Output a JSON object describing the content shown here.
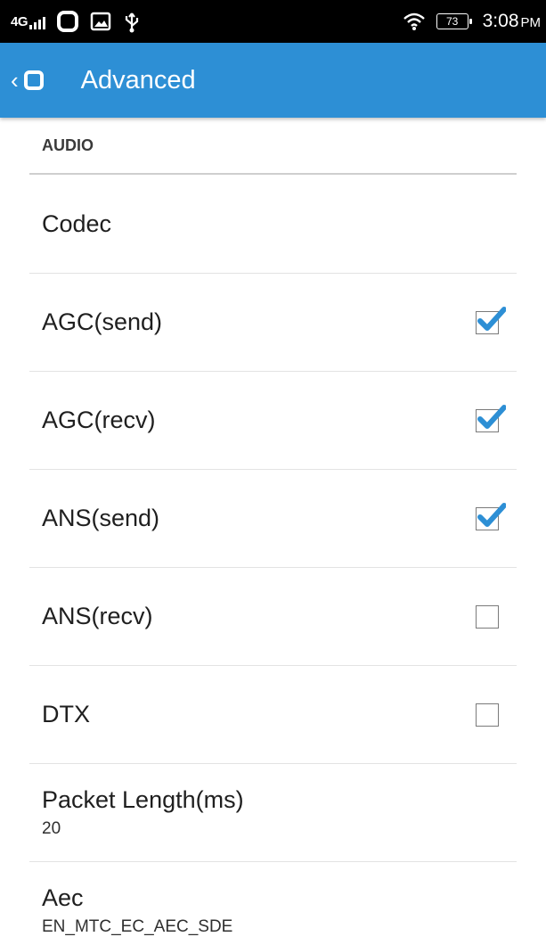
{
  "status_bar": {
    "network": "4G",
    "battery": "73",
    "time": "3:08",
    "ampm": "PM"
  },
  "app_bar": {
    "title": "Advanced"
  },
  "section": {
    "title": "AUDIO"
  },
  "settings": {
    "codec": {
      "label": "Codec"
    },
    "agc_send": {
      "label": "AGC(send)",
      "checked": true
    },
    "agc_recv": {
      "label": "AGC(recv)",
      "checked": true
    },
    "ans_send": {
      "label": "ANS(send)",
      "checked": true
    },
    "ans_recv": {
      "label": "ANS(recv)",
      "checked": false
    },
    "dtx": {
      "label": "DTX",
      "checked": false
    },
    "packet_length": {
      "label": "Packet Length(ms)",
      "value": "20"
    },
    "aec": {
      "label": "Aec",
      "value": "EN_MTC_EC_AEC_SDE"
    }
  },
  "colors": {
    "app_bar": "#2d8fd5",
    "check_accent": "#2d8fd5",
    "status_bar": "#000000"
  },
  "icons": [
    "signal-icon",
    "app-notification-icon",
    "image-icon",
    "usb-icon",
    "wifi-icon",
    "battery-icon",
    "back-chevron-icon",
    "app-logo-icon",
    "checkmark-icon"
  ]
}
